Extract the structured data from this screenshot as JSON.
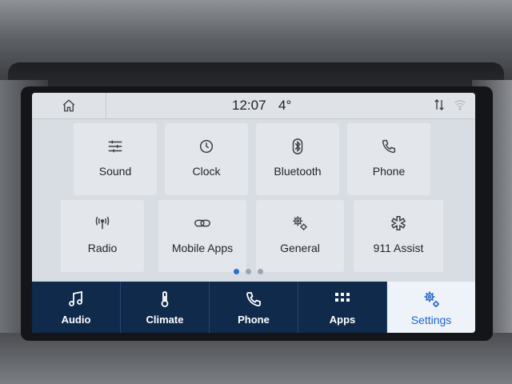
{
  "status_bar": {
    "home_icon": "home-icon",
    "time": "12:07",
    "temperature": "4°",
    "icons": [
      "data-transfer-icon",
      "wifi-icon"
    ]
  },
  "settings_tiles": [
    {
      "label": "Sound",
      "icon": "sliders-icon"
    },
    {
      "label": "Clock",
      "icon": "clock-icon"
    },
    {
      "label": "Bluetooth",
      "icon": "bluetooth-icon"
    },
    {
      "label": "Phone",
      "icon": "phone-icon"
    },
    {
      "label": "Radio",
      "icon": "radio-antenna-icon"
    },
    {
      "label": "Mobile Apps",
      "icon": "link-icon"
    },
    {
      "label": "General",
      "icon": "gears-icon"
    },
    {
      "label": "911 Assist",
      "icon": "emergency-icon"
    }
  ],
  "pager": {
    "pages": 3,
    "current": 1
  },
  "bottom_nav": [
    {
      "label": "Audio",
      "icon": "music-note-icon",
      "active": false
    },
    {
      "label": "Climate",
      "icon": "thermometer-icon",
      "active": false
    },
    {
      "label": "Phone",
      "icon": "phone-icon",
      "active": false
    },
    {
      "label": "Apps",
      "icon": "apps-grid-icon",
      "active": false
    },
    {
      "label": "Settings",
      "icon": "settings-gears-icon",
      "active": true
    }
  ],
  "colors": {
    "nav_background": "#102a4c",
    "active_accent": "#1f63c8",
    "screen_background": "#d8dde3"
  }
}
